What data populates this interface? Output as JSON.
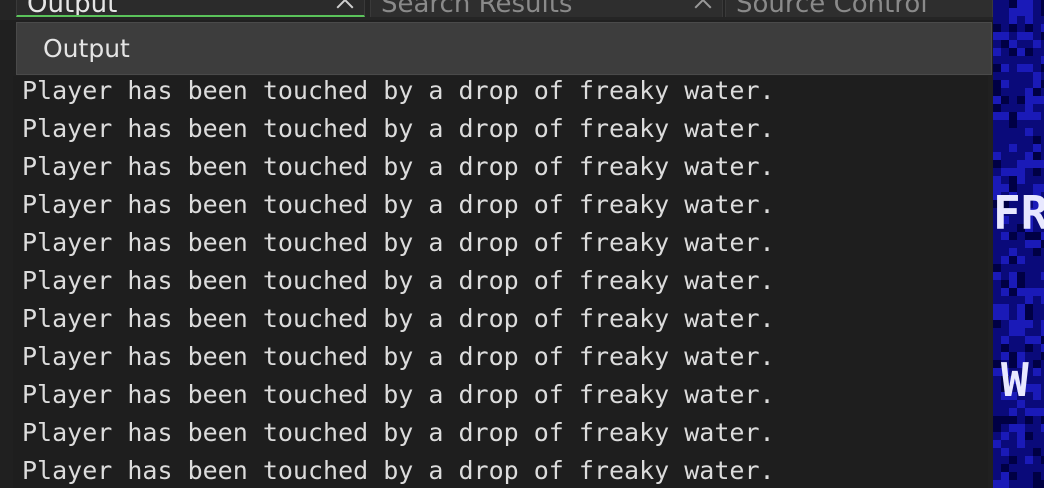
{
  "tabs": [
    {
      "label": "Output",
      "active": true
    },
    {
      "label": "Search Results",
      "active": false
    },
    {
      "label": "Source Control",
      "active": false
    }
  ],
  "output_panel": {
    "title": "Output",
    "lines": [
      "Player has been touched by a drop of freaky water.",
      "Player has been touched by a drop of freaky water.",
      "Player has been touched by a drop of freaky water.",
      "Player has been touched by a drop of freaky water.",
      "Player has been touched by a drop of freaky water.",
      "Player has been touched by a drop of freaky water.",
      "Player has been touched by a drop of freaky water.",
      "Player has been touched by a drop of freaky water.",
      "Player has been touched by a drop of freaky water.",
      "Player has been touched by a drop of freaky water.",
      "Player has been touched by a drop of freaky water."
    ]
  },
  "viewport": {
    "text_top": "FR",
    "text_bottom": "W",
    "background_color": "#0a0a7a",
    "pattern_color": "#1a1ab8"
  },
  "colors": {
    "accent": "#5bc35b",
    "log_text": "#dcdcdc"
  }
}
